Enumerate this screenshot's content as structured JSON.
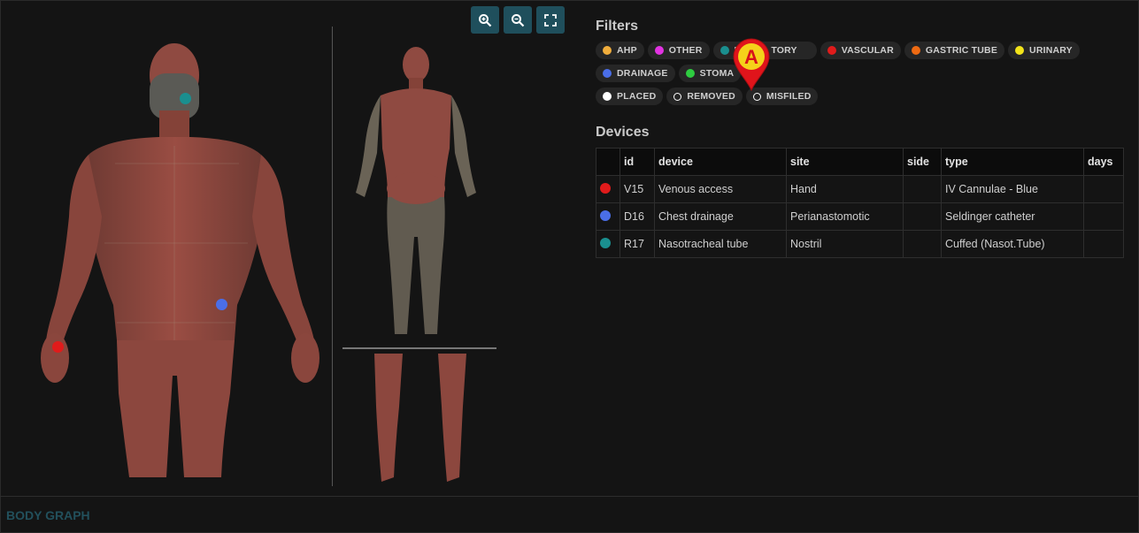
{
  "toolbar": {
    "zoom_in_icon": "zoom-in-icon",
    "zoom_out_icon": "zoom-out-icon",
    "fullscreen_icon": "fullscreen-icon"
  },
  "filters": {
    "title": "Filters",
    "categories": [
      {
        "label": "AHP",
        "color": "#f0ad3c"
      },
      {
        "label": "OTHER",
        "color": "#e233e2"
      },
      {
        "label": "R",
        "color": "#1a8f8f"
      },
      {
        "label": "TORY",
        "color": ""
      },
      {
        "label": "VASCULAR",
        "color": "#e01b1b"
      },
      {
        "label": "GASTRIC TUBE",
        "color": "#ee6a12"
      },
      {
        "label": "URINARY",
        "color": "#f2e31a"
      },
      {
        "label": "DRAINAGE",
        "color": "#4a6ee8"
      },
      {
        "label": "STOMA",
        "color": "#2ecc40"
      }
    ],
    "statuses": [
      {
        "label": "PLACED",
        "style": "filled-white"
      },
      {
        "label": "REMOVED",
        "style": "ring"
      },
      {
        "label": "MISFILED",
        "style": "ring"
      }
    ],
    "callout_letter": "A"
  },
  "devices": {
    "title": "Devices",
    "columns": [
      "id",
      "device",
      "site",
      "side",
      "type",
      "days"
    ],
    "rows": [
      {
        "color": "#e01b1b",
        "id": "V15",
        "device": "Venous access",
        "site": "Hand",
        "side": "",
        "type": "IV Cannulae - Blue",
        "days": ""
      },
      {
        "color": "#4a6ee8",
        "id": "D16",
        "device": "Chest drainage",
        "site": "Perianastomotic",
        "side": "",
        "type": "Seldinger catheter",
        "days": ""
      },
      {
        "color": "#1a8f8f",
        "id": "R17",
        "device": "Nasotracheal tube",
        "site": "Nostril",
        "side": "",
        "type": "Cuffed (Nasot.Tube)",
        "days": ""
      }
    ]
  },
  "body_markers": [
    {
      "device_id": "R17",
      "color": "#1a8f8f"
    },
    {
      "device_id": "D16",
      "color": "#4a6ee8"
    },
    {
      "device_id": "V15",
      "color": "#e01b1b"
    }
  ],
  "footer": {
    "label": "BODY GRAPH",
    "color": "#22505c"
  }
}
